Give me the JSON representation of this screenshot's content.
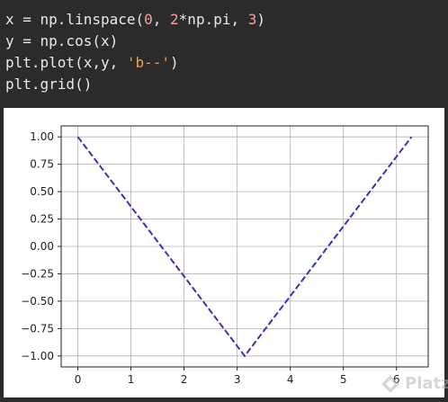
{
  "code": {
    "lines": [
      [
        {
          "t": "x = np.linspace(",
          "c": "plain"
        },
        {
          "t": "0",
          "c": "num"
        },
        {
          "t": ", ",
          "c": "plain"
        },
        {
          "t": "2",
          "c": "num"
        },
        {
          "t": "*np.pi, ",
          "c": "plain"
        },
        {
          "t": "3",
          "c": "num"
        },
        {
          "t": ")",
          "c": "plain"
        }
      ],
      [
        {
          "t": "y = np.cos(x)",
          "c": "plain"
        }
      ],
      [
        {
          "t": "plt.plot(x,y, ",
          "c": "plain"
        },
        {
          "t": "'b--'",
          "c": "str"
        },
        {
          "t": ")",
          "c": "plain"
        }
      ],
      [
        {
          "t": "plt.grid()",
          "c": "plain"
        }
      ]
    ]
  },
  "colors": {
    "line": "#3333bb",
    "grid": "#b0b0b0",
    "axes": "#222222"
  },
  "watermark": {
    "text": "Platzi",
    "icon": "platzi-logo-icon"
  },
  "chart_data": {
    "type": "line",
    "x": [
      0,
      3.14159,
      6.28319
    ],
    "series": [
      {
        "values": [
          1.0,
          -1.0,
          1.0
        ],
        "style": "dashed"
      }
    ],
    "xticks": [
      0,
      1,
      2,
      3,
      4,
      5,
      6
    ],
    "xtick_labels": [
      "0",
      "1",
      "2",
      "3",
      "4",
      "5",
      "6"
    ],
    "yticks": [
      1.0,
      0.75,
      0.5,
      0.25,
      0.0,
      -0.25,
      -0.5,
      -0.75,
      -1.0
    ],
    "ytick_labels": [
      "1.00",
      "0.75",
      "0.50",
      "0.25",
      "0.00",
      "−0.25",
      "−0.50",
      "−0.75",
      "−1.00"
    ],
    "xlim": [
      -0.314,
      6.597
    ],
    "ylim": [
      -1.1,
      1.1
    ],
    "grid": true,
    "title": "",
    "xlabel": "",
    "ylabel": ""
  }
}
